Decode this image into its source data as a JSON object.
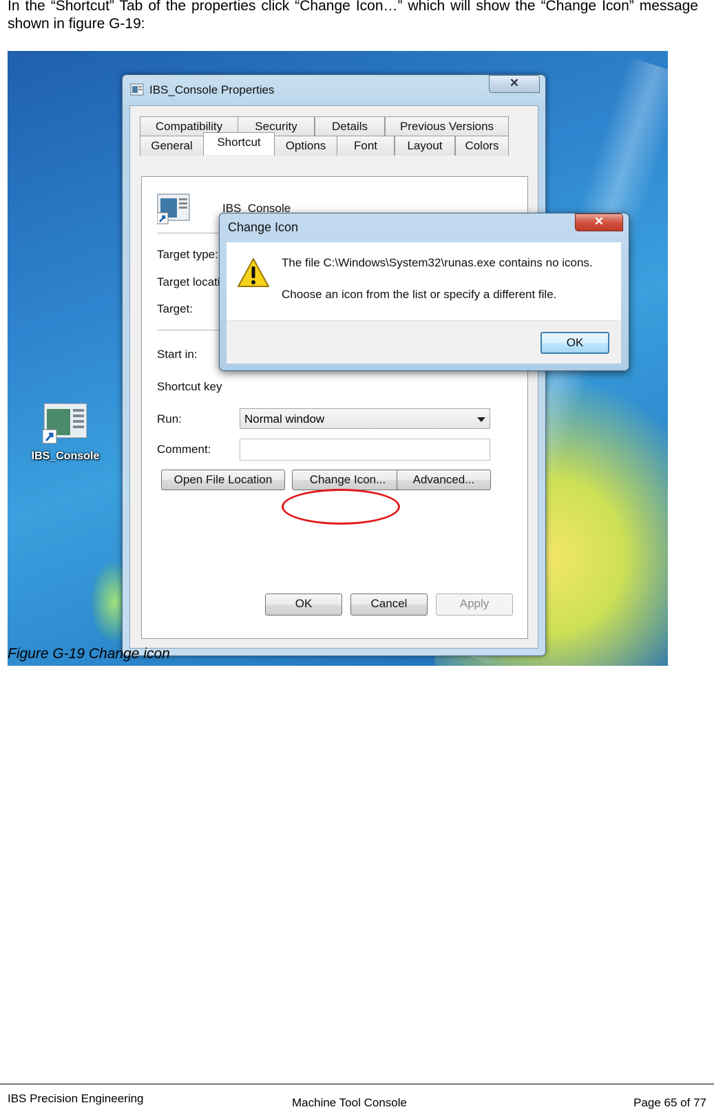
{
  "intro_text": "In the “Shortcut” Tab of the properties click “Change Icon…” which will show the “Change Icon” message shown in figure G-19:",
  "desktop": {
    "icon_label": "IBS_Console"
  },
  "properties": {
    "title": "IBS_Console Properties",
    "close": "✕",
    "tabs_row1": [
      "Compatibility",
      "Security",
      "Details",
      "Previous Versions"
    ],
    "tabs_row2": [
      "General",
      "Shortcut",
      "Options",
      "Font",
      "Layout",
      "Colors"
    ],
    "active_tab": "Shortcut",
    "shortcut_name": "IBS_Console",
    "labels": {
      "target_type": "Target type:",
      "target_location": "Target locatio",
      "target": "Target:",
      "start_in": "Start in:",
      "shortcut_key": "Shortcut key",
      "run": "Run:",
      "comment": "Comment:"
    },
    "run_value": "Normal window",
    "buttons": {
      "open_file_location": "Open File Location",
      "change_icon": "Change Icon...",
      "advanced": "Advanced...",
      "ok": "OK",
      "cancel": "Cancel",
      "apply": "Apply"
    }
  },
  "message": {
    "title": "Change Icon",
    "close": "✕",
    "line1": "The file C:\\Windows\\System32\\runas.exe contains no icons.",
    "line2": "Choose an icon from the list or specify a different file.",
    "ok": "OK"
  },
  "caption": "Figure G-19 Change icon",
  "footer": {
    "left": "IBS Precision Engineering",
    "center": "Machine Tool Console",
    "right": "Page 65 of 77"
  },
  "colors": {
    "highlight": "#e11a1a",
    "desktop_blue": "#2f86cf"
  }
}
